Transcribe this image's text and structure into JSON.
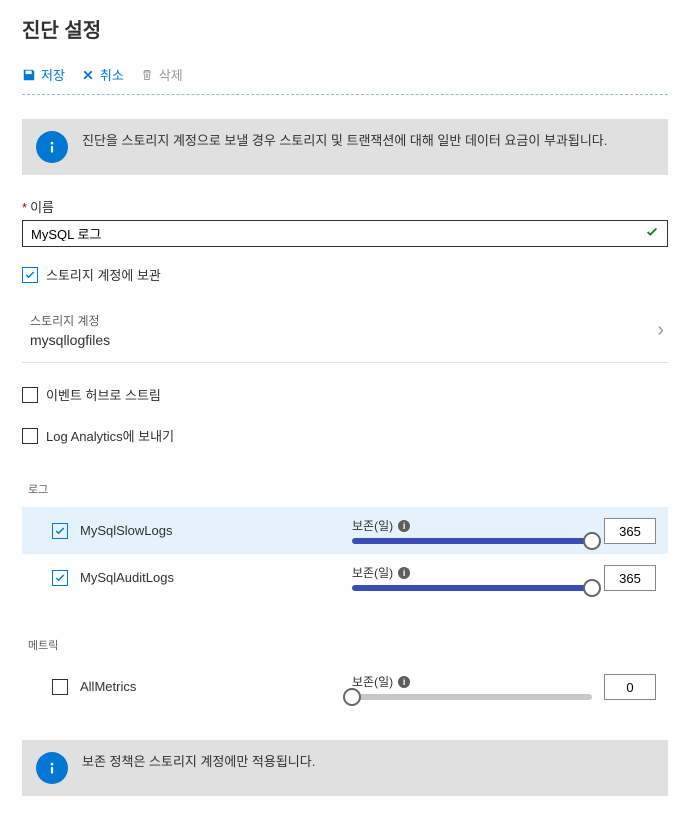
{
  "page": {
    "title": "진단 설정"
  },
  "toolbar": {
    "save_label": "저장",
    "discard_label": "취소",
    "delete_label": "삭제"
  },
  "banners": {
    "storage_charge": "진단을 스토리지 계정으로 보낼 경우 스토리지 및 트랜잭션에 대해 일반 데이터 요금이 부과됩니다.",
    "retention_note": "보존 정책은 스토리지 계정에만 적용됩니다."
  },
  "fields": {
    "name_label": "이름",
    "name_value": "MySQL 로그",
    "archive_storage_label": "스토리지 계정에 보관",
    "storage_account_label": "스토리지 계정",
    "storage_account_value": "mysqllogfiles",
    "eventhub_label": "이벤트 허브로 스트림",
    "loganalytics_label": "Log Analytics에 보내기"
  },
  "sections": {
    "logs_label": "로그",
    "metrics_label": "메트릭",
    "retention_label": "보존(일)"
  },
  "logs": [
    {
      "name": "MySqlSlowLogs",
      "checked": true,
      "retention": "365",
      "fill_pct": 100,
      "highlighted": true
    },
    {
      "name": "MySqlAuditLogs",
      "checked": true,
      "retention": "365",
      "fill_pct": 100,
      "highlighted": false
    }
  ],
  "metrics": [
    {
      "name": "AllMetrics",
      "checked": false,
      "retention": "0",
      "fill_pct": 0,
      "highlighted": false
    }
  ],
  "checkboxes": {
    "archive_storage": true,
    "eventhub": false,
    "loganalytics": false
  }
}
